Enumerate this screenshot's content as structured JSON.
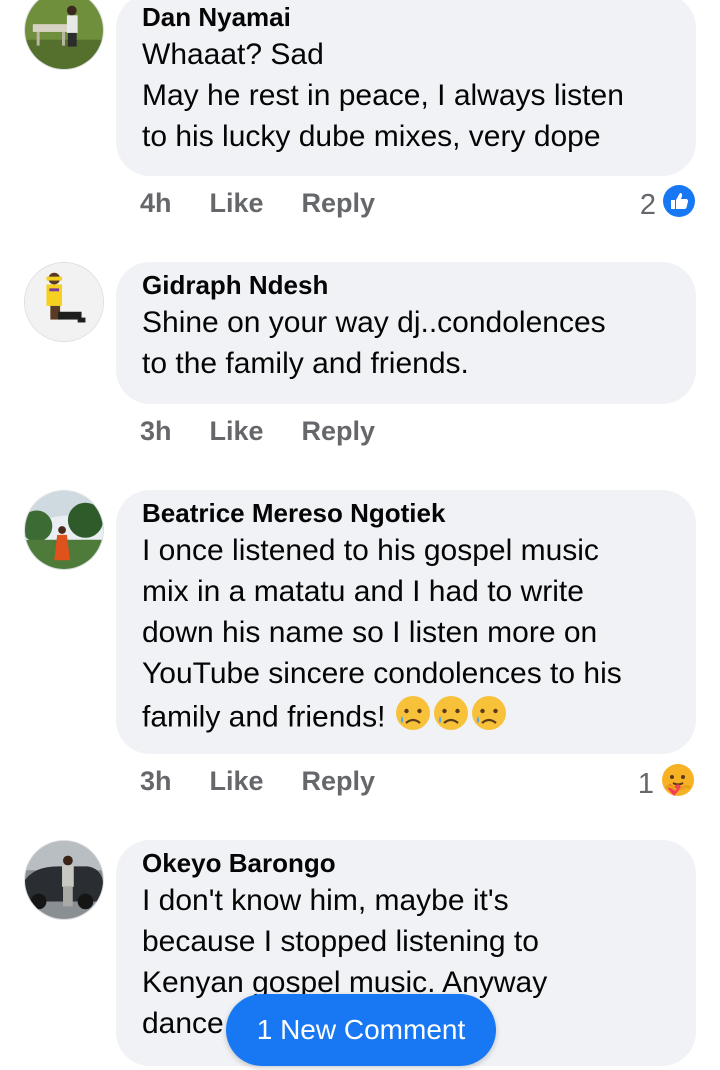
{
  "comments": [
    {
      "author": "Dan Nyamai",
      "text": "Whaaat? Sad\nMay he rest in peace, I always listen\nto his lucky dube mixes, very dope",
      "time": "4h",
      "like_label": "Like",
      "reply_label": "Reply",
      "reaction_count": "2",
      "reaction_icon": "like-icon"
    },
    {
      "author": "Gidraph Ndesh",
      "text": "Shine on your way dj..condolences\nto the family and friends.",
      "time": "3h",
      "like_label": "Like",
      "reply_label": "Reply"
    },
    {
      "author": "Beatrice Mereso Ngotiek",
      "text": "I once listened to his gospel music\nmix in a matatu and I had to write\ndown his name so I listen more on\nYouTube sincere condolences to his\nfamily and friends! ",
      "time": "3h",
      "like_label": "Like",
      "reply_label": "Reply",
      "reaction_count": "1",
      "reaction_icon": "care-icon"
    },
    {
      "author": "Okeyo Barongo",
      "text": "I don't know him, maybe it's\nbecause I stopped listening to\nKenyan gospel music. Anyway\ndance"
    }
  ],
  "new_comment_button": "1 New Comment",
  "colors": {
    "bubble": "#f0f2f5",
    "meta_text": "#65676b",
    "accent": "#1877f2"
  }
}
